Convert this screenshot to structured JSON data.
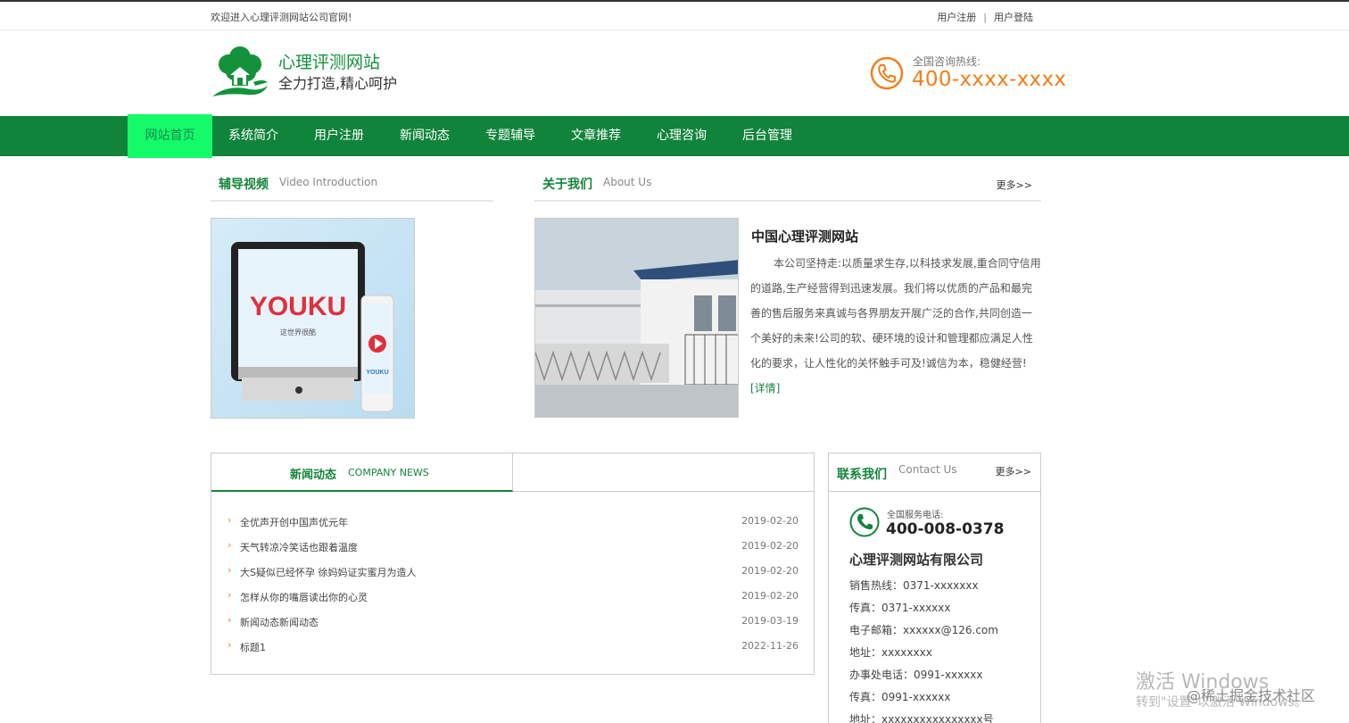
{
  "topbar": {
    "welcome": "欢迎进入心理评测网站公司官网!",
    "register": "用户注册",
    "separator": "|",
    "login": "用户登陆"
  },
  "header": {
    "site_name": "心理评测网站",
    "slogan": "全力打造,精心呵护",
    "hotline_label": "全国咨询热线:",
    "hotline_number": "400-xxxx-xxxx"
  },
  "nav": {
    "items": [
      {
        "label": "网站首页",
        "active": true
      },
      {
        "label": "系统简介",
        "active": false
      },
      {
        "label": "用户注册",
        "active": false
      },
      {
        "label": "新闻动态",
        "active": false
      },
      {
        "label": "专题辅导",
        "active": false
      },
      {
        "label": "文章推荐",
        "active": false
      },
      {
        "label": "心理咨询",
        "active": false
      },
      {
        "label": "后台管理",
        "active": false
      }
    ]
  },
  "video_section": {
    "title": "辅导视频",
    "subtitle": "Video Introduction",
    "image_text": "YOUKU",
    "image_subtext": "这世界很酷"
  },
  "about_section": {
    "title": "关于我们",
    "subtitle": "About Us",
    "more": "更多>>",
    "heading": "中国心理评测网站",
    "body": "本公司坚持走:以质量求生存,以科技求发展,重合同守信用的道路,生产经营得到迅速发展。我们将以优质的产品和最完善的售后服务来真诚与各界朋友开展广泛的合作,共同创造一个美好的未来!公司的软、硬环境的设计和管理都应满足人性化的要求，让人性化的关怀触手可及!诚信为本，稳健经营!",
    "detail_link": "[详情]"
  },
  "news_section": {
    "title": "新闻动态",
    "subtitle": "COMPANY NEWS",
    "arrow": "›",
    "items": [
      {
        "title": "全优声开创中国声优元年",
        "date": "2019-02-20"
      },
      {
        "title": "天气转凉冷笑话也跟着温度",
        "date": "2019-02-20"
      },
      {
        "title": "大S疑似已经怀孕 徐妈妈证实蜜月为造人",
        "date": "2019-02-20"
      },
      {
        "title": "怎样从你的嘴唇读出你的心灵",
        "date": "2019-02-20"
      },
      {
        "title": "新闻动态新闻动态",
        "date": "2019-03-19"
      },
      {
        "title": "标题1",
        "date": "2022-11-26"
      }
    ]
  },
  "contact_section": {
    "title": "联系我们",
    "subtitle": "Contact Us",
    "more": "更多>>",
    "service_label": "全国服务电话:",
    "service_number": "400-008-0378",
    "company": "心理评测网站有限公司",
    "rows": [
      "销售热线：0371-xxxxxxx",
      "传真：0371-xxxxxx",
      "电子邮箱：xxxxxx@126.com",
      "地址：xxxxxxxx",
      "办事处电话：0991-xxxxxx",
      "传真：0991-xxxxxx",
      "地址：xxxxxxxxxxxxxxxx号"
    ]
  },
  "watermark": {
    "line1": "激活 Windows",
    "line2": "转到\"设置\"以激活 Windows。",
    "community": "@稀土掘金技术社区"
  },
  "colors": {
    "brand_green": "#11843b",
    "active_nav": "#13fb68",
    "accent_orange": "#ef7f1b"
  }
}
